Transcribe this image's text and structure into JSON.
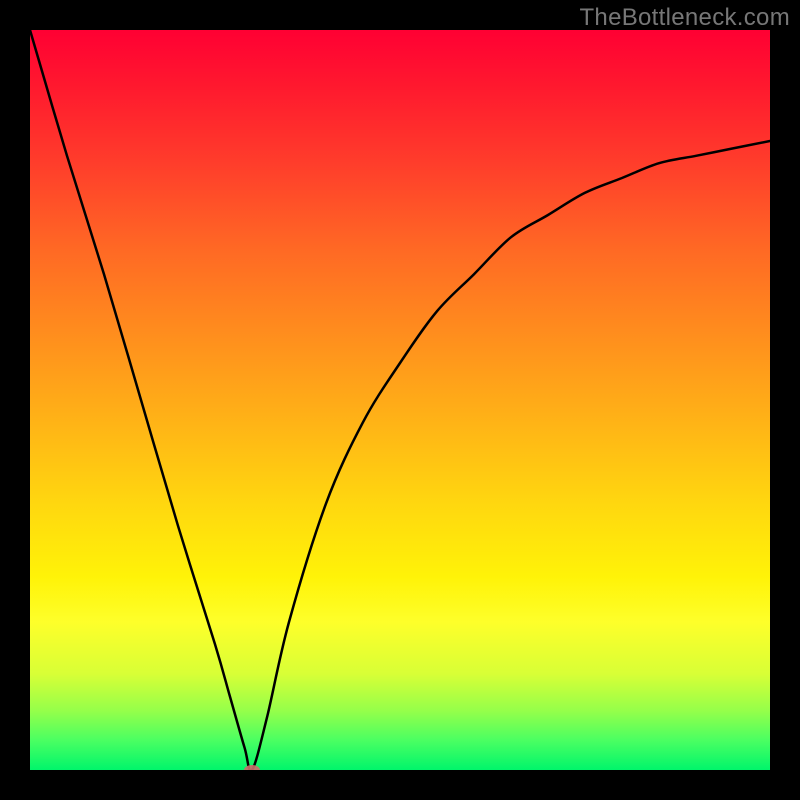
{
  "attribution": "TheBottleneck.com",
  "colors": {
    "frame": "#000000",
    "gradient_top": "#ff0033",
    "gradient_mid": "#ffd70f",
    "gradient_bottom": "#00f56b",
    "curve": "#000000",
    "marker": "#cc6b6b"
  },
  "chart_data": {
    "type": "line",
    "title": "",
    "xlabel": "",
    "ylabel": "",
    "xlim": [
      0,
      100
    ],
    "ylim": [
      0,
      100
    ],
    "grid": false,
    "series": [
      {
        "name": "bottleneck-curve",
        "x": [
          0,
          5,
          10,
          15,
          20,
          25,
          27,
          29,
          30,
          32,
          35,
          40,
          45,
          50,
          55,
          60,
          65,
          70,
          75,
          80,
          85,
          90,
          95,
          100
        ],
        "y": [
          100,
          83,
          67,
          50,
          33,
          17,
          10,
          3,
          0,
          7,
          20,
          36,
          47,
          55,
          62,
          67,
          72,
          75,
          78,
          80,
          82,
          83,
          84,
          85
        ]
      }
    ],
    "annotations": [
      {
        "name": "minimum-marker",
        "x": 30,
        "y": 0
      }
    ]
  }
}
